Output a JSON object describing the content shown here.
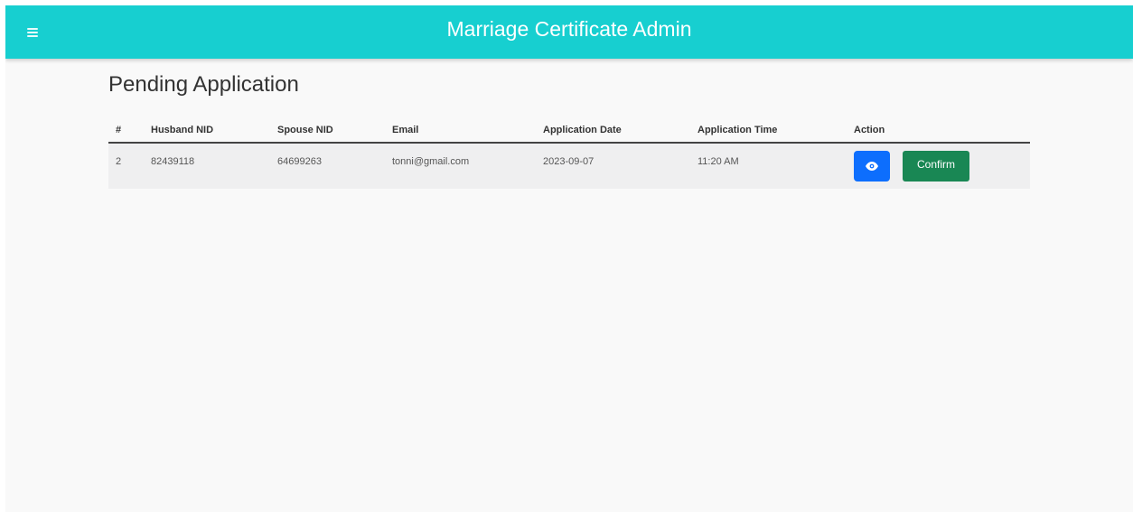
{
  "header": {
    "title": "Marriage Certificate Admin",
    "menu_icon": "hamburger-menu-icon",
    "background": "#17cfd0"
  },
  "page": {
    "title": "Pending Application"
  },
  "table": {
    "columns": [
      "#",
      "Husband NID",
      "Spouse NID",
      "Email",
      "Application Date",
      "Application Time",
      "Action"
    ],
    "rows": [
      {
        "index": "2",
        "husband_nid": "82439118",
        "spouse_nid": "64699263",
        "email": "tonni@gmail.com",
        "application_date": "2023-09-07",
        "application_time": "11:20 AM",
        "view_icon": "eye-icon",
        "confirm_label": "Confirm"
      }
    ]
  },
  "colors": {
    "view_button": "#0d6efd",
    "confirm_button": "#198754"
  }
}
